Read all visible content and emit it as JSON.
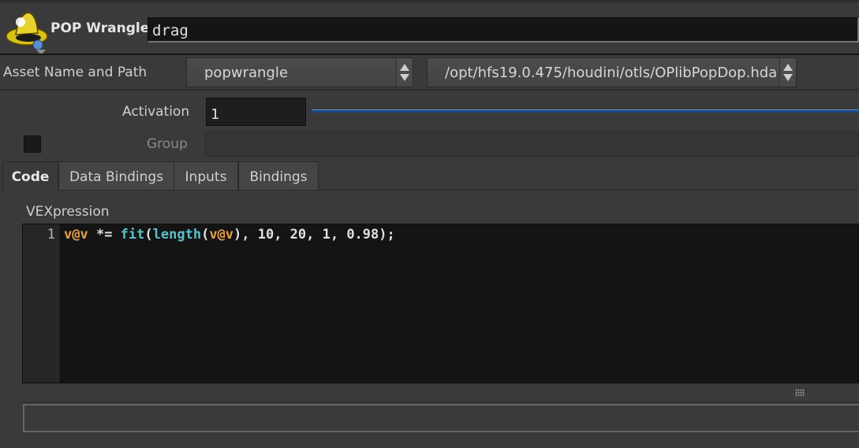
{
  "header": {
    "node_type": "POP Wrangle",
    "node_name": "drag"
  },
  "asset": {
    "label": "Asset Name and Path",
    "name": "popwrangle",
    "path": "/opt/hfs19.0.475/houdini/otls/OPlibPopDop.hda"
  },
  "activation": {
    "label": "Activation",
    "value": "1"
  },
  "group": {
    "label": "Group",
    "value": ""
  },
  "tabs": [
    {
      "label": "Code",
      "active": true
    },
    {
      "label": "Data Bindings",
      "active": false
    },
    {
      "label": "Inputs",
      "active": false
    },
    {
      "label": "Bindings",
      "active": false
    }
  ],
  "editor": {
    "label": "VEXpression",
    "line_number": "1",
    "tokens": {
      "t1": "v@v",
      "t2": " *= ",
      "t3": "fit",
      "t4": "(",
      "t5": "length",
      "t6": "(",
      "t7": "v@v",
      "t8": "), 10, 20, 1, 0.98);"
    }
  },
  "colors": {
    "keyword_var": "#e3a04a",
    "keyword_fn": "#58c2c8",
    "slider": "#1a4a8a"
  }
}
